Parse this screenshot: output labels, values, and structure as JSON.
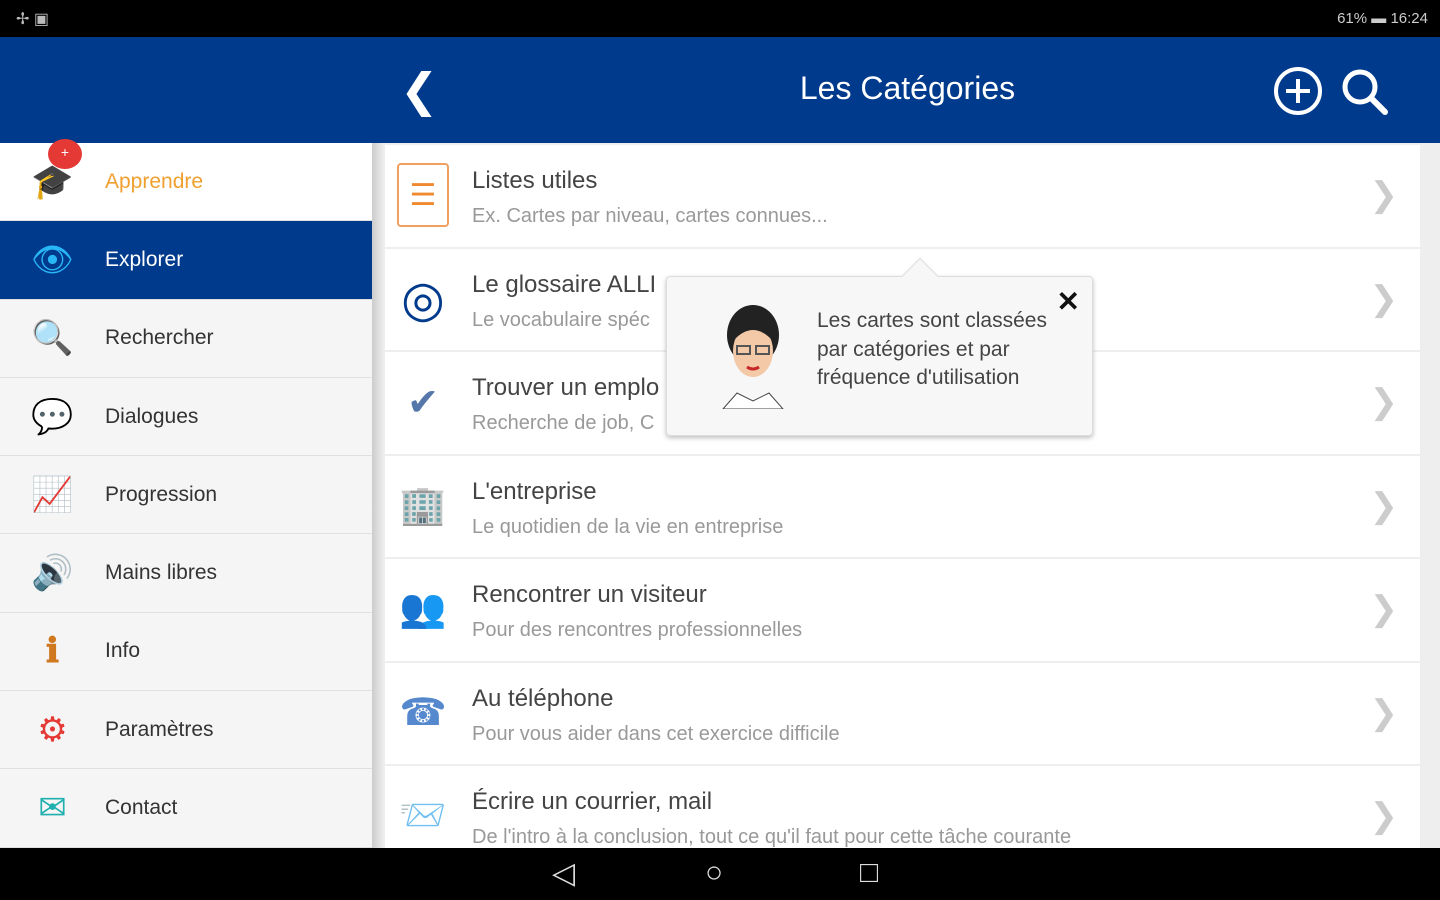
{
  "status_bar": {
    "left_icons": "✢ ▣",
    "signal": "61%",
    "time": "16:24"
  },
  "header": {
    "title": "Les Catégories",
    "back_icon": "chevron-left",
    "add_icon": "plus-circle",
    "search_icon": "search"
  },
  "sidebar": {
    "badge": "+",
    "items": [
      {
        "label": "Apprendre",
        "icon": "graduation-cap",
        "glyph": "🎓"
      },
      {
        "label": "Explorer",
        "icon": "eye",
        "glyph": "👁"
      },
      {
        "label": "Rechercher",
        "icon": "magnifier",
        "glyph": "🔍"
      },
      {
        "label": "Dialogues",
        "icon": "chat-bubbles",
        "glyph": "💬"
      },
      {
        "label": "Progression",
        "icon": "progress-graph",
        "glyph": "📈"
      },
      {
        "label": "Mains libres",
        "icon": "speaker",
        "glyph": "🔊"
      },
      {
        "label": "Info",
        "icon": "info",
        "glyph": "ℹ"
      },
      {
        "label": "Paramètres",
        "icon": "gear",
        "glyph": "⚙"
      },
      {
        "label": "Contact",
        "icon": "envelope",
        "glyph": "✉"
      }
    ]
  },
  "categories": [
    {
      "title": "Listes utiles",
      "subtitle": "Ex. Cartes par niveau, cartes connues...",
      "icon": "list",
      "glyph": "☰"
    },
    {
      "title": "Le glossaire ALLI",
      "subtitle": "Le vocabulaire spéc",
      "icon": "allianz-logo",
      "glyph": "◎"
    },
    {
      "title": "Trouver un emplo",
      "subtitle": "Recherche de job, C",
      "icon": "checkmark-papers",
      "glyph": "✔"
    },
    {
      "title": "L'entreprise",
      "subtitle": "Le quotidien de la vie en entreprise",
      "icon": "building",
      "glyph": "🏢"
    },
    {
      "title": "Rencontrer un visiteur",
      "subtitle": "Pour des rencontres professionnelles",
      "icon": "people",
      "glyph": "👥"
    },
    {
      "title": "Au téléphone",
      "subtitle": "Pour vous aider dans cet exercice difficile",
      "icon": "telephone",
      "glyph": "☎"
    },
    {
      "title": "Écrire un courrier, mail",
      "subtitle": "De l'intro à la conclusion, tout ce qu'il faut pour cette tâche courante",
      "icon": "mail-send",
      "glyph": "📨"
    }
  ],
  "popup": {
    "text": "Les cartes sont classées par catégories et par fréquence d'utilisation",
    "close": "✕"
  },
  "nav": {
    "back": "◁",
    "home": "○",
    "recents": "□"
  },
  "colors": {
    "primary": "#003a8c",
    "accent": "#f0a030",
    "badge": "#e53935"
  }
}
